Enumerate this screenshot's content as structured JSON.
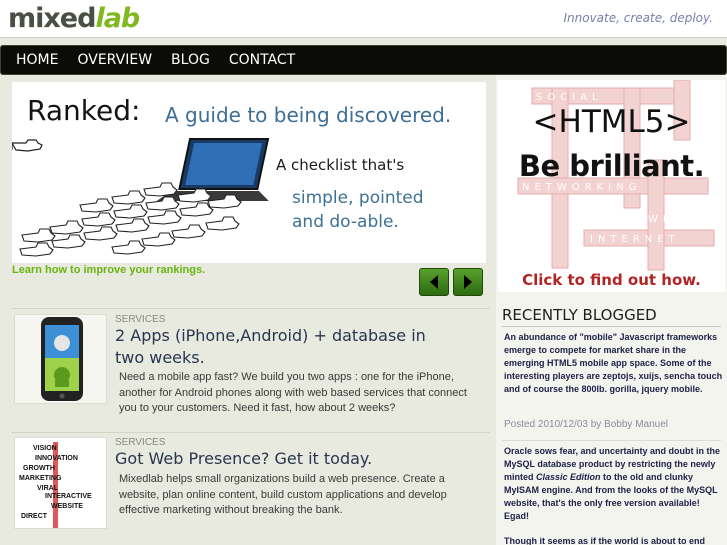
{
  "header": {
    "logo_part1": "mixed",
    "logo_part2": "lab",
    "tagline": "Innovate, create, deploy."
  },
  "nav": {
    "items": [
      {
        "label": "HOME"
      },
      {
        "label": "OVERVIEW"
      },
      {
        "label": "BLOG"
      },
      {
        "label": "CONTACT"
      }
    ]
  },
  "banner": {
    "title": "Ranked:",
    "subtitle": "A guide to being discovered.",
    "checklist_line": "A checklist that's",
    "line2": "simple, pointed",
    "line3": "and do-able.",
    "link": "Learn how to improve your rankings."
  },
  "slider": {
    "prev_icon": "chevron-left-icon",
    "next_icon": "chevron-right-icon"
  },
  "services": [
    {
      "category": "SERVICES",
      "title": "2 Apps (iPhone,Android) + database in two weeks.",
      "description": "Need a mobile app fast? We build you two apps : one for the iPhone, another for Android phones along with web based services that connect you to your customers. Need it fast, how about 2 weeks?"
    },
    {
      "category": "SERVICES",
      "title": "Got Web Presence? Get it today.",
      "description": "Mixedlab helps small organizations build a web presence.  Create a website, plan online content, build custom applications and  develop effective marketing without breaking the bank."
    }
  ],
  "thumb2_words": [
    "VISION",
    "INNOVATION",
    "GROWTH",
    "MARKETING",
    "VIRAL",
    "INTERACTIVE",
    "WEBSITE",
    "DIRECT"
  ],
  "ad": {
    "headline": "<HTML5>",
    "subhead": "Be brilliant.",
    "cta": "Click to find out how.",
    "bg_words": [
      "SOCIAL",
      "NETWORKING",
      "INTERNET",
      "WEB"
    ]
  },
  "recently_blogged": {
    "heading": "RECENTLY BLOGGED",
    "posts": [
      {
        "text": "An abundance of \"mobile\" Javascript frameworks emerge to compete for market share in the emerging HTML5 mobile app space. Some of the interesting players are zeptojs, xuijs, sencha touch and of course the 800lb. gorilla, jquery mobile.",
        "meta": "Posted 2010/12/03 by Bobby Manuel"
      },
      {
        "text_before": "Oracle sows fear, and uncertainty and doubt in the MySQL database product by restricting the newly minted ",
        "text_em": "Classic Edition",
        "text_after": " to the old and clunky MyISAM engine. And from the looks of the MySQL website, that's the only free version available! Egad!"
      },
      {
        "text": "Though it seems as if the world is about to end"
      }
    ]
  },
  "colors": {
    "nav_bg": "#0b0c07",
    "brand_green": "#7fb91f",
    "link_green": "#68b50f",
    "ad_red": "#b32424"
  }
}
